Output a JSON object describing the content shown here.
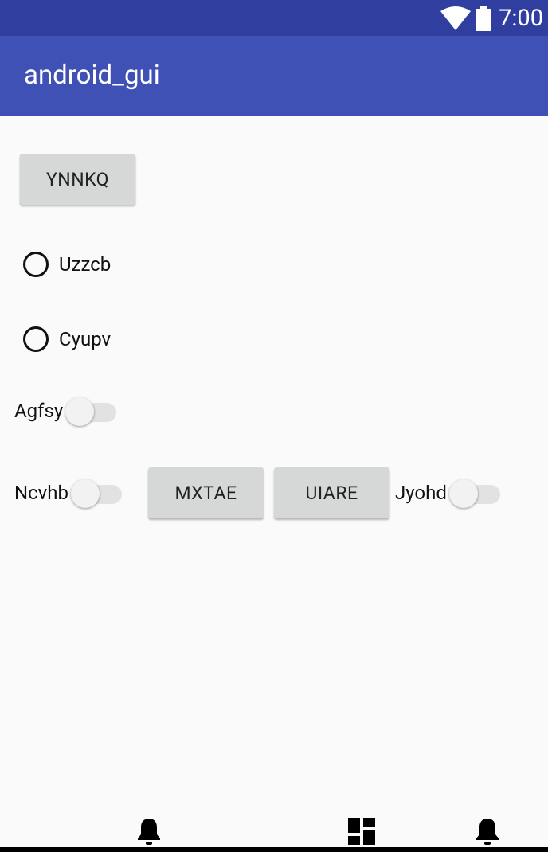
{
  "status_bar": {
    "time": "7:00",
    "icons": [
      "wifi-icon",
      "battery-icon"
    ]
  },
  "app_bar": {
    "title": "android_gui"
  },
  "buttons": {
    "ynnkq": "YNNKQ",
    "mxtae": "MXTAE",
    "uiare": "UIARE"
  },
  "radios": [
    {
      "label": "Uzzcb",
      "checked": false
    },
    {
      "label": "Cyupv",
      "checked": false
    }
  ],
  "switches": [
    {
      "label": "Agfsy",
      "on": false
    },
    {
      "label": "Ncvhb",
      "on": false
    },
    {
      "label": "Jyohd",
      "on": false
    }
  ],
  "bottom_icons": [
    "bell-icon",
    "dashboard-icon",
    "bell-icon"
  ],
  "colors": {
    "status_bar": "#303f9f",
    "app_bar": "#3f51b5",
    "button": "#d6d7d7",
    "background": "#fafafa"
  }
}
